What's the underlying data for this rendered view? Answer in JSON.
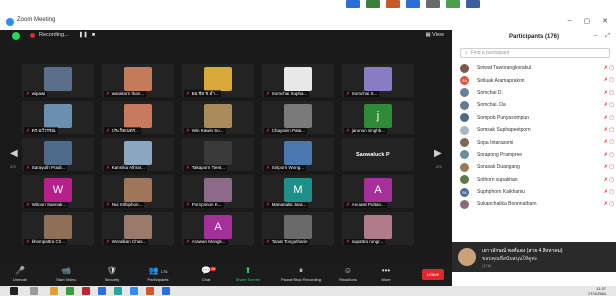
{
  "window": {
    "title": "Zoom Meeting"
  },
  "topbar": {
    "recording_label": "Recording...",
    "view_label": "View"
  },
  "navigation": {
    "left_page": "2/3",
    "right_page": "2/3"
  },
  "tiles": [
    {
      "name": "wipawi",
      "initial": "",
      "color": "#5b6e8a"
    },
    {
      "name": "warakorn than...",
      "initial": "",
      "color": "#c47b5a"
    },
    {
      "name": "ผอ.ชัย ช.อำ...",
      "initial": "",
      "color": "#d9a83a"
    },
    {
      "name": "Somchai Supha...",
      "initial": "",
      "color": "#e8e8e8"
    },
    {
      "name": "Somchai S...",
      "initial": "",
      "color": "#8a7cc4"
    },
    {
      "name": "ดร.ฉวีวรรณ",
      "initial": "",
      "color": "#6a8fb0"
    },
    {
      "name": "ประกิตเนตร...",
      "initial": "",
      "color": "#c97a5e"
    },
    {
      "name": "Win Kawin So...",
      "initial": "",
      "color": "#a98b5c"
    },
    {
      "name": "Chayanin Pata...",
      "initial": "",
      "color": "#7a7a7a"
    },
    {
      "name": "jarunun singhb...",
      "initial": "j",
      "color": "#2f8b3a"
    },
    {
      "name": "Sarayuth Pradi...",
      "initial": "",
      "color": "#4d6b8a"
    },
    {
      "name": "Kannika Athrar...",
      "initial": "",
      "color": "#8aa6c1"
    },
    {
      "name": "Takaporn Tient...",
      "initial": "",
      "color": "#3a3a3a"
    },
    {
      "name": "Siriporn Wong...",
      "initial": "",
      "color": "#4a78b0"
    },
    {
      "name": "Saowaluck P",
      "initial": "",
      "color": "transparent",
      "speaking": true
    },
    {
      "name": "Witoon Saenak...",
      "initial": "W",
      "color": "#b6208a"
    },
    {
      "name": "Nui Sithiphon...",
      "initial": "",
      "color": "#a0765a"
    },
    {
      "name": "Pornpimon K...",
      "initial": "",
      "color": "#8c6b8a"
    },
    {
      "name": "Mananalai Jara...",
      "initial": "M",
      "color": "#1f8f8a"
    },
    {
      "name": "Anuwat Puttan...",
      "initial": "A",
      "color": "#a72f9a"
    },
    {
      "name": "khompattra Ch...",
      "initial": "",
      "color": "#8f6f55"
    },
    {
      "name": "Woralkan Chas...",
      "initial": "",
      "color": "#9a7a6a"
    },
    {
      "name": "Arawan Mongk...",
      "initial": "A",
      "color": "#a72f9a"
    },
    {
      "name": "Tanat Tongutharin",
      "initial": "",
      "color": "#6a6a6a"
    },
    {
      "name": "supattra rungr...",
      "initial": "",
      "color": "#b07c8a"
    }
  ],
  "toolbar": {
    "unmute": "Unmute",
    "stop_video": "Start Video",
    "security": "Security",
    "participants": "Participants",
    "participants_count": "176",
    "chat": "Chat",
    "chat_badge": "16",
    "share": "Share Screen",
    "record": "Pause/Stop Recording",
    "reactions": "Reactions",
    "more": "More",
    "leave": "Leave"
  },
  "panel": {
    "title": "Participants (176)",
    "search_placeholder": "Find a participant",
    "participants": [
      {
        "name": "Siriwat Taworangkorakul",
        "color": "#7a5a4a",
        "initials": ""
      },
      {
        "name": "Siriluak Aramaprakon",
        "color": "#e0553a",
        "initials": "SA"
      },
      {
        "name": "Somchai D.",
        "color": "#6a7f9a",
        "initials": ""
      },
      {
        "name": "Somchai. Da",
        "color": "#5f7a9a",
        "initials": ""
      },
      {
        "name": "Sompob Punyasompun",
        "color": "#4a6a8a",
        "initials": ""
      },
      {
        "name": "Somsak Suphapeetporn",
        "color": "#a9b7c4",
        "initials": ""
      },
      {
        "name": "Sopa Intarasomi",
        "color": "#7a6a5a",
        "initials": ""
      },
      {
        "name": "Sorapong Prampree",
        "color": "#6a8f9a",
        "initials": ""
      },
      {
        "name": "Sorasak Duangang",
        "color": "#9a7a5a",
        "initials": ""
      },
      {
        "name": "Srithorn supakhan",
        "color": "#5a7a4a",
        "initials": ""
      },
      {
        "name": "Suphphorn Kaikhamu",
        "color": "#4a6aa0",
        "initials": "SK"
      },
      {
        "name": "Sukanchalika Boonnatham",
        "color": "#8a6a7a",
        "initials": ""
      }
    ]
  },
  "chat_popup": {
    "sender": "เยาวลักษณ์ พงศ์แสง (สาย 4 สิงหาคม)",
    "message": "ขอบคุณที่สนับสนุนให้ดูค่ะ",
    "count": "(176)"
  },
  "taskbar": {
    "time": "11:37",
    "date": "27/4/2564"
  }
}
